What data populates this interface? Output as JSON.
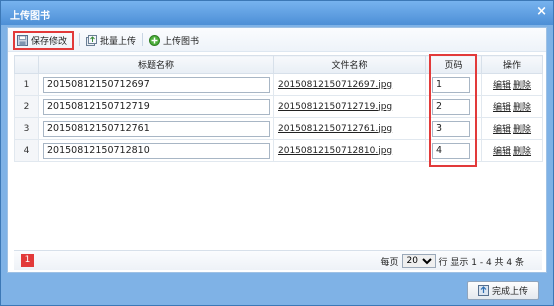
{
  "dialog": {
    "title": "上传图书"
  },
  "toolbar": {
    "save_label": "保存修改",
    "batch_upload_label": "批量上传",
    "upload_label": "上传图书"
  },
  "table": {
    "headers": {
      "title": "标题名称",
      "file": "文件名称",
      "page": "页码",
      "ops": "操作"
    },
    "rows": [
      {
        "num": "1",
        "title": "20150812150712697",
        "file": "20150812150712697.jpg",
        "page": "1",
        "edit": "编辑",
        "delete": "删除"
      },
      {
        "num": "2",
        "title": "20150812150712719",
        "file": "20150812150712719.jpg",
        "page": "2",
        "edit": "编辑",
        "delete": "删除"
      },
      {
        "num": "3",
        "title": "20150812150712761",
        "file": "20150812150712761.jpg",
        "page": "3",
        "edit": "编辑",
        "delete": "删除"
      },
      {
        "num": "4",
        "title": "20150812150712810",
        "file": "20150812150712810.jpg",
        "page": "4",
        "edit": "编辑",
        "delete": "删除"
      }
    ]
  },
  "pager": {
    "current_page": "1",
    "per_page_label": "每页",
    "per_page_value": "20",
    "summary": "行 显示 1 - 4 共 4 条"
  },
  "footer": {
    "finish_label": "完成上传"
  },
  "colors": {
    "highlight": "#e23a3a",
    "titlebar": "#4d8fd6"
  }
}
